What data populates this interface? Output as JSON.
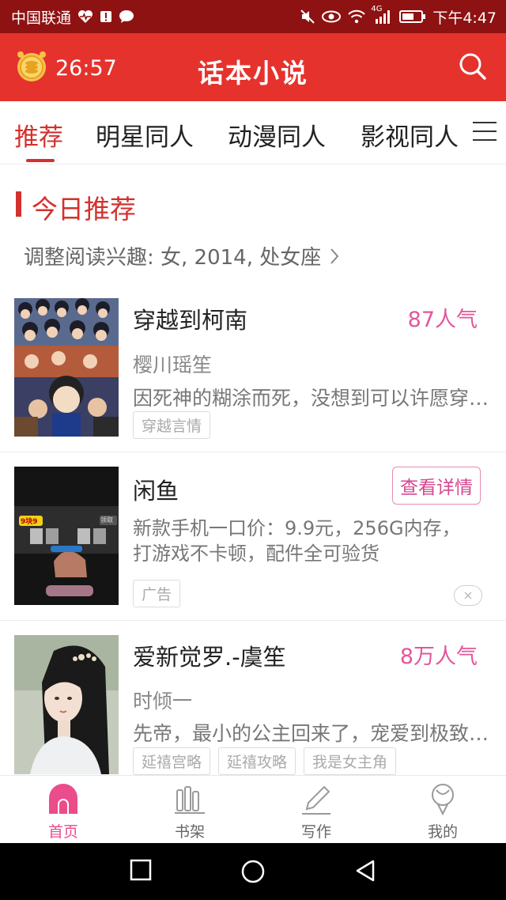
{
  "status_bar": {
    "carrier": "中国联通",
    "network": "4G",
    "time": "下午4:47"
  },
  "header": {
    "timer": "26:57",
    "title": "话本小说"
  },
  "tabs": [
    {
      "label": "推荐",
      "active": true
    },
    {
      "label": "明星同人",
      "active": false
    },
    {
      "label": "动漫同人",
      "active": false
    },
    {
      "label": "影视同人",
      "active": false
    }
  ],
  "section": {
    "title": "今日推荐",
    "interest": "调整阅读兴趣: 女, 2014, 处女座"
  },
  "books": [
    {
      "title": "穿越到柯南",
      "popularity": "87人气",
      "author": "樱川瑶笙",
      "description": "因死神的糊涂而死，没想到可以许愿穿越到柯南的世界",
      "tags": [
        "穿越言情"
      ]
    },
    {
      "title": "爱新觉罗.-虞笙",
      "popularity": "8万人气",
      "author": "时倾一",
      "description": "先帝，最小的公主回来了，宠爱到极致的她",
      "tags": [
        "延禧宫略",
        "延禧攻略",
        "我是女主角"
      ]
    }
  ],
  "ad": {
    "title": "闲鱼",
    "button": "查看详情",
    "description_line1": "新款手机一口价：9.9元，256G内存，",
    "description_line2": "打游戏不卡顿，配件全可验货",
    "badge": "广告",
    "image_label_left": "9块9",
    "image_label_right": "领取"
  },
  "bottom_nav": [
    {
      "label": "首页",
      "active": true
    },
    {
      "label": "书架",
      "active": false
    },
    {
      "label": "写作",
      "active": false
    },
    {
      "label": "我的",
      "active": false
    }
  ],
  "colors": {
    "header_red": "#e5322d",
    "status_bar": "#8e1212",
    "accent_red": "#d3312d",
    "popularity_pink": "#e2579a",
    "nav_active_pink": "#ea4c8c"
  }
}
